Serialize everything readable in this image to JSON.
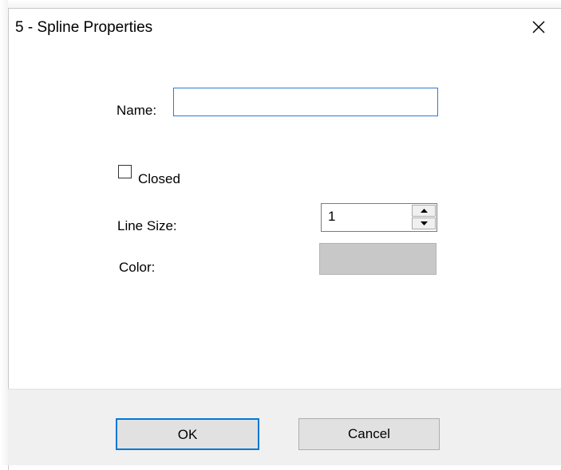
{
  "dialog": {
    "title": "5 - Spline Properties",
    "close_icon": "close-icon"
  },
  "form": {
    "name_label": "Name:",
    "name_value": "",
    "closed_label": "Closed",
    "closed_checked": false,
    "line_size_label": "Line Size:",
    "line_size_value": "1",
    "color_label": "Color:",
    "color_value": "#c8c8c8"
  },
  "buttons": {
    "ok_label": "OK",
    "cancel_label": "Cancel"
  },
  "colors": {
    "accent": "#0078d7",
    "input_focus_border": "#2b7bd6",
    "footer_bg": "#f0f0f0"
  }
}
